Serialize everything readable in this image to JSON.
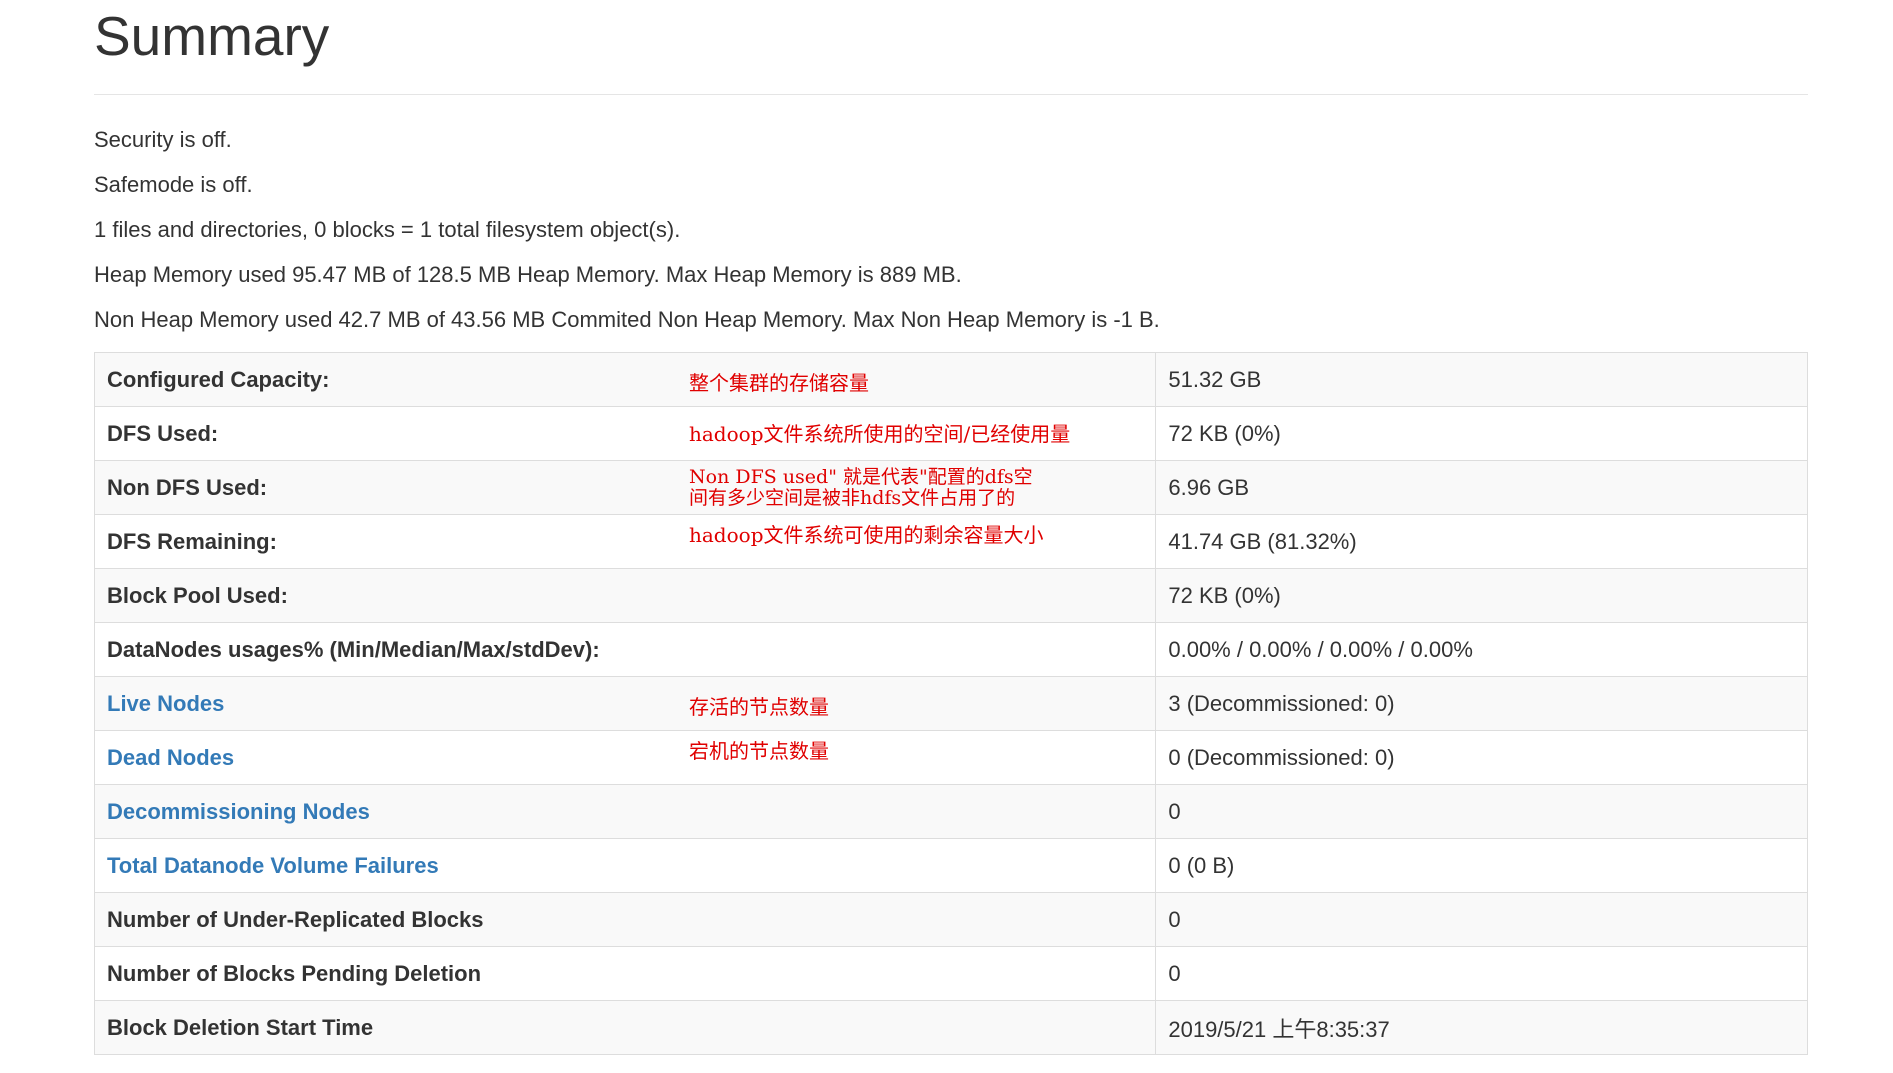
{
  "page": {
    "title": "Summary"
  },
  "info": {
    "security": "Security is off.",
    "safemode": "Safemode is off.",
    "objects": "1 files and directories, 0 blocks = 1 total filesystem object(s).",
    "heap": "Heap Memory used 95.47 MB of 128.5 MB Heap Memory. Max Heap Memory is 889 MB.",
    "non_heap": "Non Heap Memory used 42.7 MB of 43.56 MB Commited Non Heap Memory. Max Non Heap Memory is -1 B."
  },
  "table": {
    "rows": [
      {
        "label": "Configured Capacity:",
        "value": "51.32 GB",
        "link": false,
        "annotation": "整个集群的存储容量"
      },
      {
        "label": "DFS Used:",
        "value": "72 KB (0%)",
        "link": false,
        "annotation": "hadoop文件系统所使用的空间/已经使用量"
      },
      {
        "label": "Non DFS Used:",
        "value": "6.96 GB",
        "link": false,
        "annotation_line1": "Non DFS used\" 就是代表\"配置的dfs空",
        "annotation_line2": "间有多少空间是被非hdfs文件占用了的"
      },
      {
        "label": "DFS Remaining:",
        "value": "41.74 GB (81.32%)",
        "link": false,
        "annotation": "hadoop文件系统可使用的剩余容量大小"
      },
      {
        "label": "Block Pool Used:",
        "value": "72 KB (0%)",
        "link": false
      },
      {
        "label": "DataNodes usages% (Min/Median/Max/stdDev):",
        "value": "0.00% / 0.00% / 0.00% / 0.00%",
        "link": false
      },
      {
        "label": "Live Nodes",
        "value": "3 (Decommissioned: 0)",
        "link": true,
        "annotation": "存活的节点数量"
      },
      {
        "label": "Dead Nodes",
        "value": "0 (Decommissioned: 0)",
        "link": true,
        "annotation": "宕机的节点数量"
      },
      {
        "label": "Decommissioning Nodes",
        "value": "0",
        "link": true
      },
      {
        "label": "Total Datanode Volume Failures",
        "value": "0 (0 B)",
        "link": true
      },
      {
        "label": "Number of Under-Replicated Blocks",
        "value": "0",
        "link": false
      },
      {
        "label": "Number of Blocks Pending Deletion",
        "value": "0",
        "link": false
      },
      {
        "label": "Block Deletion Start Time",
        "value": "2019/5/21 上午8:35:37",
        "link": false
      }
    ]
  },
  "colors": {
    "link": "#337ab7",
    "annotation": "#e00000",
    "row_stripe": "#f9f9f9",
    "border": "#dddddd"
  }
}
